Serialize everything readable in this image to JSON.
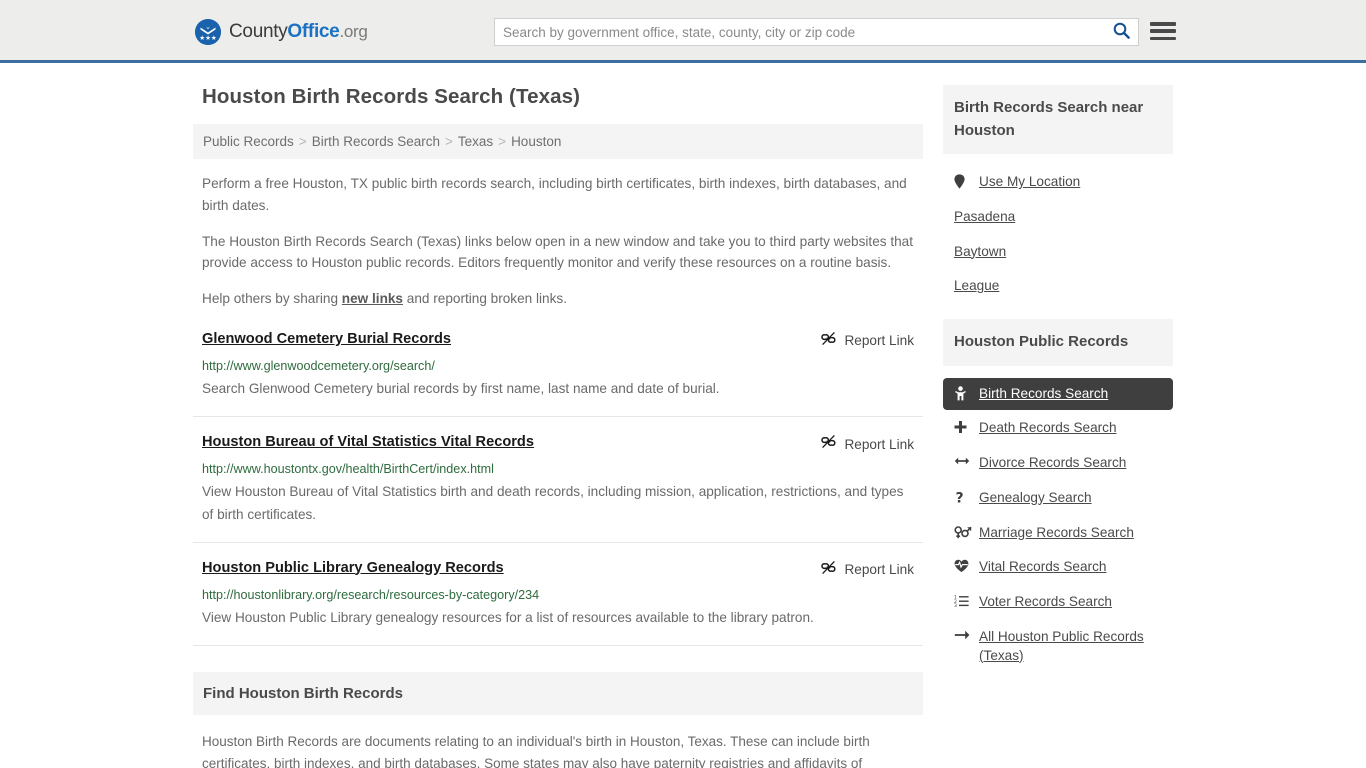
{
  "header": {
    "logo": {
      "icon": "eagle-shield-logo-icon",
      "text_1": "County",
      "text_2": "Office",
      "text_3": ".org"
    },
    "search": {
      "placeholder": "Search by government office, state, county, city or zip code",
      "value": "",
      "icon": "search-icon"
    },
    "menu_icon": "hamburger-menu-icon",
    "accent_color": "#3c6e9f",
    "background_color": "#ededeb"
  },
  "main": {
    "page_title": "Houston Birth Records Search (Texas)",
    "breadcrumb": [
      "Public Records",
      "Birth Records Search",
      "Texas",
      "Houston"
    ],
    "breadcrumb_separator": ">",
    "intro": {
      "p1": "Perform a free Houston, TX public birth records search, including birth certificates, birth indexes, birth databases, and birth dates.",
      "p2": "The Houston Birth Records Search (Texas) links below open in a new window and take you to third party websites that provide access to Houston public records. Editors frequently monitor and verify these resources on a routine basis.",
      "p3_before": "Help others by sharing ",
      "p3_link": "new links",
      "p3_after": " and reporting broken links."
    },
    "report_link_label": "Report Link",
    "report_link_icon": "broken-link-icon",
    "results": [
      {
        "title": "Glenwood Cemetery Burial Records",
        "url": "http://www.glenwoodcemetery.org/search/",
        "description": "Search Glenwood Cemetery burial records by first name, last name and date of burial."
      },
      {
        "title": "Houston Bureau of Vital Statistics Vital Records",
        "url": "http://www.houstontx.gov/health/BirthCert/index.html",
        "description": "View Houston Bureau of Vital Statistics birth and death records, including mission, application, restrictions, and types of birth certificates."
      },
      {
        "title": "Houston Public Library Genealogy Records",
        "url": "http://houstonlibrary.org/research/resources-by-category/234",
        "description": "View Houston Public Library genealogy resources for a list of resources available to the library patron."
      }
    ],
    "section": {
      "heading": "Find Houston Birth Records",
      "body": "Houston Birth Records are documents relating to an individual's birth in Houston, Texas. These can include birth certificates, birth indexes, and birth databases. Some states may also have paternity registries and affidavits of"
    },
    "url_color": "#2f6b3e"
  },
  "sidebar": {
    "near_card": {
      "heading": "Birth Records Search near Houston",
      "items": [
        {
          "label": "Use My Location",
          "icon": "map-pin-icon"
        },
        {
          "label": "Pasadena",
          "icon": ""
        },
        {
          "label": "Baytown",
          "icon": ""
        },
        {
          "label": "League",
          "icon": ""
        }
      ]
    },
    "records_card": {
      "heading": "Houston Public Records",
      "items": [
        {
          "label": "Birth Records Search",
          "icon": "baby-icon",
          "active": true
        },
        {
          "label": "Death Records Search",
          "icon": "cross-icon",
          "active": false
        },
        {
          "label": "Divorce Records Search",
          "icon": "arrows-left-right-icon",
          "active": false
        },
        {
          "label": "Genealogy Search",
          "icon": "question-mark-icon",
          "active": false
        },
        {
          "label": "Marriage Records Search",
          "icon": "venus-mars-icon",
          "active": false
        },
        {
          "label": "Vital Records Search",
          "icon": "heartbeat-icon",
          "active": false
        },
        {
          "label": "Voter Records Search",
          "icon": "ordered-list-icon",
          "active": false
        },
        {
          "label": "All Houston Public Records (Texas)",
          "icon": "arrow-right-icon",
          "active": false
        }
      ],
      "active_background": "#3f3f3f"
    }
  }
}
